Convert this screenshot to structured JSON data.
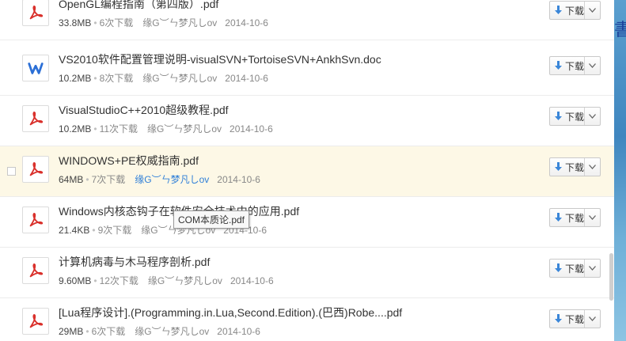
{
  "files": [
    {
      "name": "OpenGL编程指南（第四版）.pdf",
      "type": "pdf",
      "size": "33.8MB",
      "downloads": "6次下载",
      "uploader": "缘G︶ㄣ梦凡しov",
      "date": "2014-10-6"
    },
    {
      "name": "VS2010软件配置管理说明-visualSVN+TortoiseSVN+AnkhSvn.doc",
      "type": "doc",
      "size": "10.2MB",
      "downloads": "8次下载",
      "uploader": "缘G︶ㄣ梦凡しov",
      "date": "2014-10-6"
    },
    {
      "name": "VisualStudioC++2010超级教程.pdf",
      "type": "pdf",
      "size": "10.2MB",
      "downloads": "11次下载",
      "uploader": "缘G︶ㄣ梦凡しov",
      "date": "2014-10-6"
    },
    {
      "name": "WINDOWS+PE权威指南.pdf",
      "type": "pdf",
      "size": "64MB",
      "downloads": "7次下载",
      "uploader": "缘G︶ㄣ梦凡しov",
      "date": "2014-10-6"
    },
    {
      "name": "Windows内核态钩子在软件安全技术中的应用.pdf",
      "type": "pdf",
      "size": "21.4KB",
      "downloads": "9次下载",
      "uploader": "缘G︶ㄣ梦凡しov",
      "date": "2014-10-6"
    },
    {
      "name": "计算机病毒与木马程序剖析.pdf",
      "type": "pdf",
      "size": "9.60MB",
      "downloads": "12次下载",
      "uploader": "缘G︶ㄣ梦凡しov",
      "date": "2014-10-6"
    },
    {
      "name": "[Lua程序设计].(Programming.in.Lua,Second.Edition).(巴西)Robe....pdf",
      "type": "pdf",
      "size": "29MB",
      "downloads": "6次下载",
      "uploader": "缘G︶ㄣ梦凡しov",
      "date": "2014-10-6"
    }
  ],
  "download_label": "下载",
  "tooltip": "COM本质论.pdf",
  "colors": {
    "pdf_red": "#d9302b",
    "doc_blue": "#2b6fd6",
    "hover_bg": "#fdf8e6",
    "link_blue": "#2f7fd8"
  },
  "icons": {
    "pdf": "pdf-file-icon",
    "doc": "word-file-icon",
    "download": "download-arrow-icon",
    "dropdown": "chevron-down-icon"
  }
}
